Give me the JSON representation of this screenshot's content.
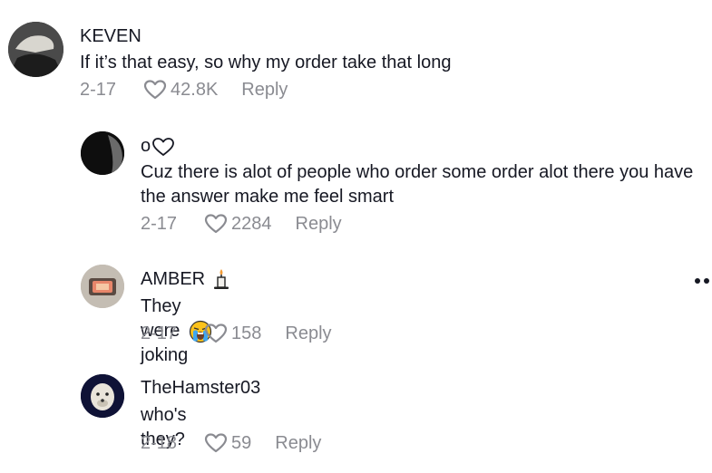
{
  "comments": [
    {
      "username": "KEVEN",
      "text": "If it’s that easy, so why my order take that long",
      "date": "2-17",
      "likes": "42.8K",
      "reply": "Reply",
      "avatar_icon": "avatar-photo"
    },
    {
      "username": "o",
      "username_suffix_icon": "heart-outline",
      "text": "Cuz there is alot of people who order some order alot there you have the answer make me feel smart",
      "date": "2-17",
      "likes": "2284",
      "reply": "Reply",
      "avatar_icon": "avatar-photo"
    },
    {
      "username": "AMBER",
      "username_suffix_icon": "candle-emoji",
      "text": "They were joking",
      "text_suffix_icon": "loudly-crying-emoji",
      "date": "2-17",
      "likes": "158",
      "reply": "Reply",
      "avatar_icon": "avatar-photo"
    },
    {
      "username": "TheHamster03",
      "text": "who's they?",
      "date": "2-18",
      "likes": "59",
      "reply": "Reply",
      "avatar_icon": "avatar-photo"
    }
  ],
  "colors": {
    "primary_text": "#161823",
    "secondary_text": "#8a8b91",
    "background": "#ffffff"
  }
}
